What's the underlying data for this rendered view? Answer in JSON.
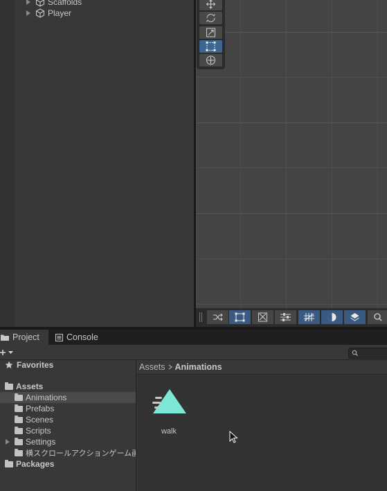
{
  "hierarchy": {
    "items": [
      {
        "label": "Scaffolds"
      },
      {
        "label": "Player"
      }
    ]
  },
  "scene": {
    "tools": [
      "move-tool",
      "rotate-tool",
      "scale-tool",
      "rect-tool",
      "transform-tool"
    ],
    "active_tool": "rect-tool",
    "overlay_buttons": [
      "shuffle",
      "rect",
      "transform-gizmo",
      "sliders",
      "grid",
      "shading",
      "snapping",
      "search"
    ]
  },
  "tabs": [
    {
      "label": "Project"
    },
    {
      "label": "Console"
    }
  ],
  "project": {
    "favorites_label": "Favorites",
    "assets_label": "Assets",
    "folders": [
      {
        "label": "Animations",
        "selected": true
      },
      {
        "label": "Prefabs"
      },
      {
        "label": "Scenes"
      },
      {
        "label": "Scripts"
      },
      {
        "label": "Settings"
      },
      {
        "label": "横スクロールアクションゲーム画像素"
      }
    ],
    "packages_label": "Packages",
    "breadcrumb": {
      "root": "Assets",
      "current": "Animations"
    },
    "asset": {
      "label": "walk",
      "color": "#7ee8d6"
    }
  },
  "colors": {
    "selection": "#3d6591",
    "asset_icon": "#7ee8d6"
  }
}
